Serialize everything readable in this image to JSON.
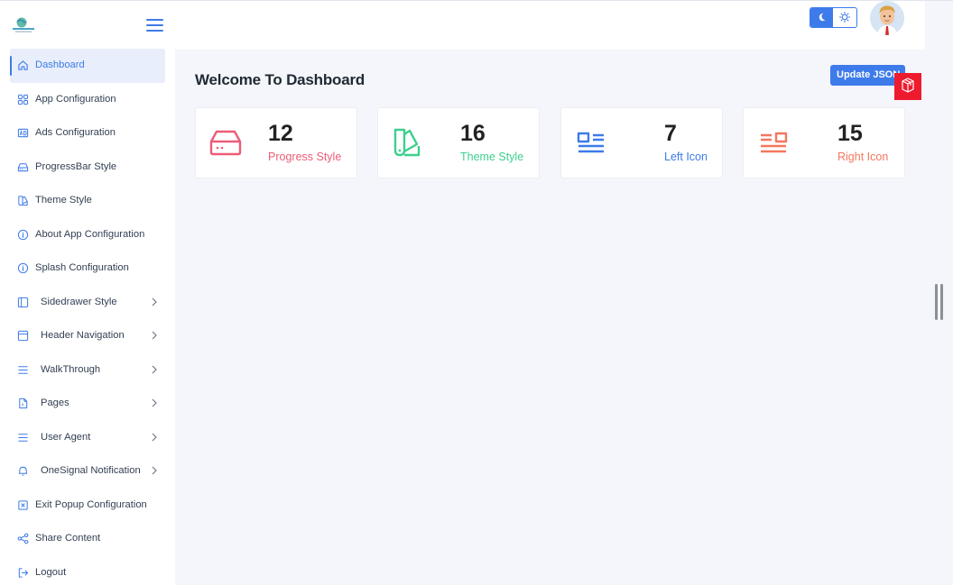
{
  "sidebar": {
    "logo_icon": "globe-logo",
    "menu_icon": "hamburger-icon",
    "items": [
      {
        "label": "Dashboard",
        "icon": "home-icon",
        "active": true,
        "has_submenu": false
      },
      {
        "label": "App Configuration",
        "icon": "grid-icon",
        "active": false,
        "has_submenu": false
      },
      {
        "label": "Ads Configuration",
        "icon": "ad-icon",
        "active": false,
        "has_submenu": false
      },
      {
        "label": "ProgressBar Style",
        "icon": "progressbar-icon",
        "active": false,
        "has_submenu": false
      },
      {
        "label": "Theme Style",
        "icon": "swatch-icon",
        "active": false,
        "has_submenu": false
      },
      {
        "label": "About App Configuration",
        "icon": "info-icon",
        "active": false,
        "has_submenu": false
      },
      {
        "label": "Splash Configuration",
        "icon": "info-icon",
        "active": false,
        "has_submenu": false
      },
      {
        "label": "Sidedrawer Style",
        "icon": "sidebar-layout-icon",
        "active": false,
        "has_submenu": true
      },
      {
        "label": "Header Navigation",
        "icon": "window-icon",
        "active": false,
        "has_submenu": true
      },
      {
        "label": "WalkThrough",
        "icon": "menu-lines-icon",
        "active": false,
        "has_submenu": true
      },
      {
        "label": "Pages",
        "icon": "file-icon",
        "active": false,
        "has_submenu": true
      },
      {
        "label": "User Agent",
        "icon": "menu-lines-icon",
        "active": false,
        "has_submenu": true
      },
      {
        "label": "OneSignal Notification",
        "icon": "bell-icon",
        "active": false,
        "has_submenu": true
      },
      {
        "label": "Exit Popup Configuration",
        "icon": "close-square-icon",
        "active": false,
        "has_submenu": false
      },
      {
        "label": "Share Content",
        "icon": "share-icon",
        "active": false,
        "has_submenu": false
      },
      {
        "label": "Logout",
        "icon": "logout-icon",
        "active": false,
        "has_submenu": false
      }
    ]
  },
  "header": {
    "theme_dark_icon": "moon-icon",
    "theme_light_icon": "sun-icon",
    "avatar_icon": "user-avatar"
  },
  "main": {
    "title": "Welcome To Dashboard",
    "update_button": "Update JSON",
    "badge_icon": "cube-icon",
    "cards": [
      {
        "value": "12",
        "label": "Progress Style",
        "color": "#ec5d78",
        "icon": "storage-drive-icon"
      },
      {
        "value": "16",
        "label": "Theme Style",
        "color": "#3ecf8e",
        "icon": "swatch-icon"
      },
      {
        "value": "7",
        "label": "Left Icon",
        "color": "#3d7be8",
        "icon": "left-icon-layout"
      },
      {
        "value": "15",
        "label": "Right Icon",
        "color": "#f4775e",
        "icon": "right-icon-layout"
      }
    ]
  },
  "colors": {
    "accent": "#3e7bea",
    "badge": "#ee1b2e",
    "background": "#f5f6fb"
  }
}
